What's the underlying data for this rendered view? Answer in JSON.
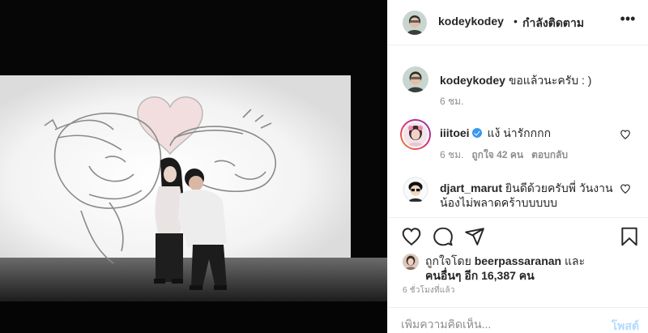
{
  "header": {
    "username": "kodeykodey",
    "separator": "•",
    "follow_status": "กำลังติดตาม",
    "more_icon": "more-horizontal-icon"
  },
  "caption": {
    "username": "kodeykodey",
    "text": "ขอแล้วนะครับ : )",
    "time": "6 ชม."
  },
  "comments": [
    {
      "username": "iiitoei",
      "verified": true,
      "text": "แง้ น่ารักกกก",
      "time": "6 ชม.",
      "likes": "ถูกใจ 42 คน",
      "reply": "ตอบกลับ"
    },
    {
      "username": "djart_marut",
      "text_line1": "ยินดีด้วยครับพี่ วันงาน",
      "text_line2": "น้องไม่พลาดคร้าบบบบบ"
    }
  ],
  "actions": {
    "like_icon": "heart-icon",
    "comment_icon": "comment-icon",
    "share_icon": "send-icon",
    "save_icon": "bookmark-icon"
  },
  "likes": {
    "prefix": "ถูกใจโดย",
    "first_user": "beerpassaranan",
    "and": "และ",
    "others": "คนอื่นๆ อีก 16,387 คน"
  },
  "timestamp": "6 ชั่วโมงที่แล้ว",
  "add_comment": {
    "placeholder": "เพิ่มความคิดเห็น...",
    "post_label": "โพสต์"
  },
  "colors": {
    "text": "#262626",
    "muted": "#8e8e8e",
    "verified": "#3897f0",
    "post_disabled": "#b3dbff",
    "story_ring_start": "#f58529",
    "story_ring_end": "#dd2a7b"
  }
}
